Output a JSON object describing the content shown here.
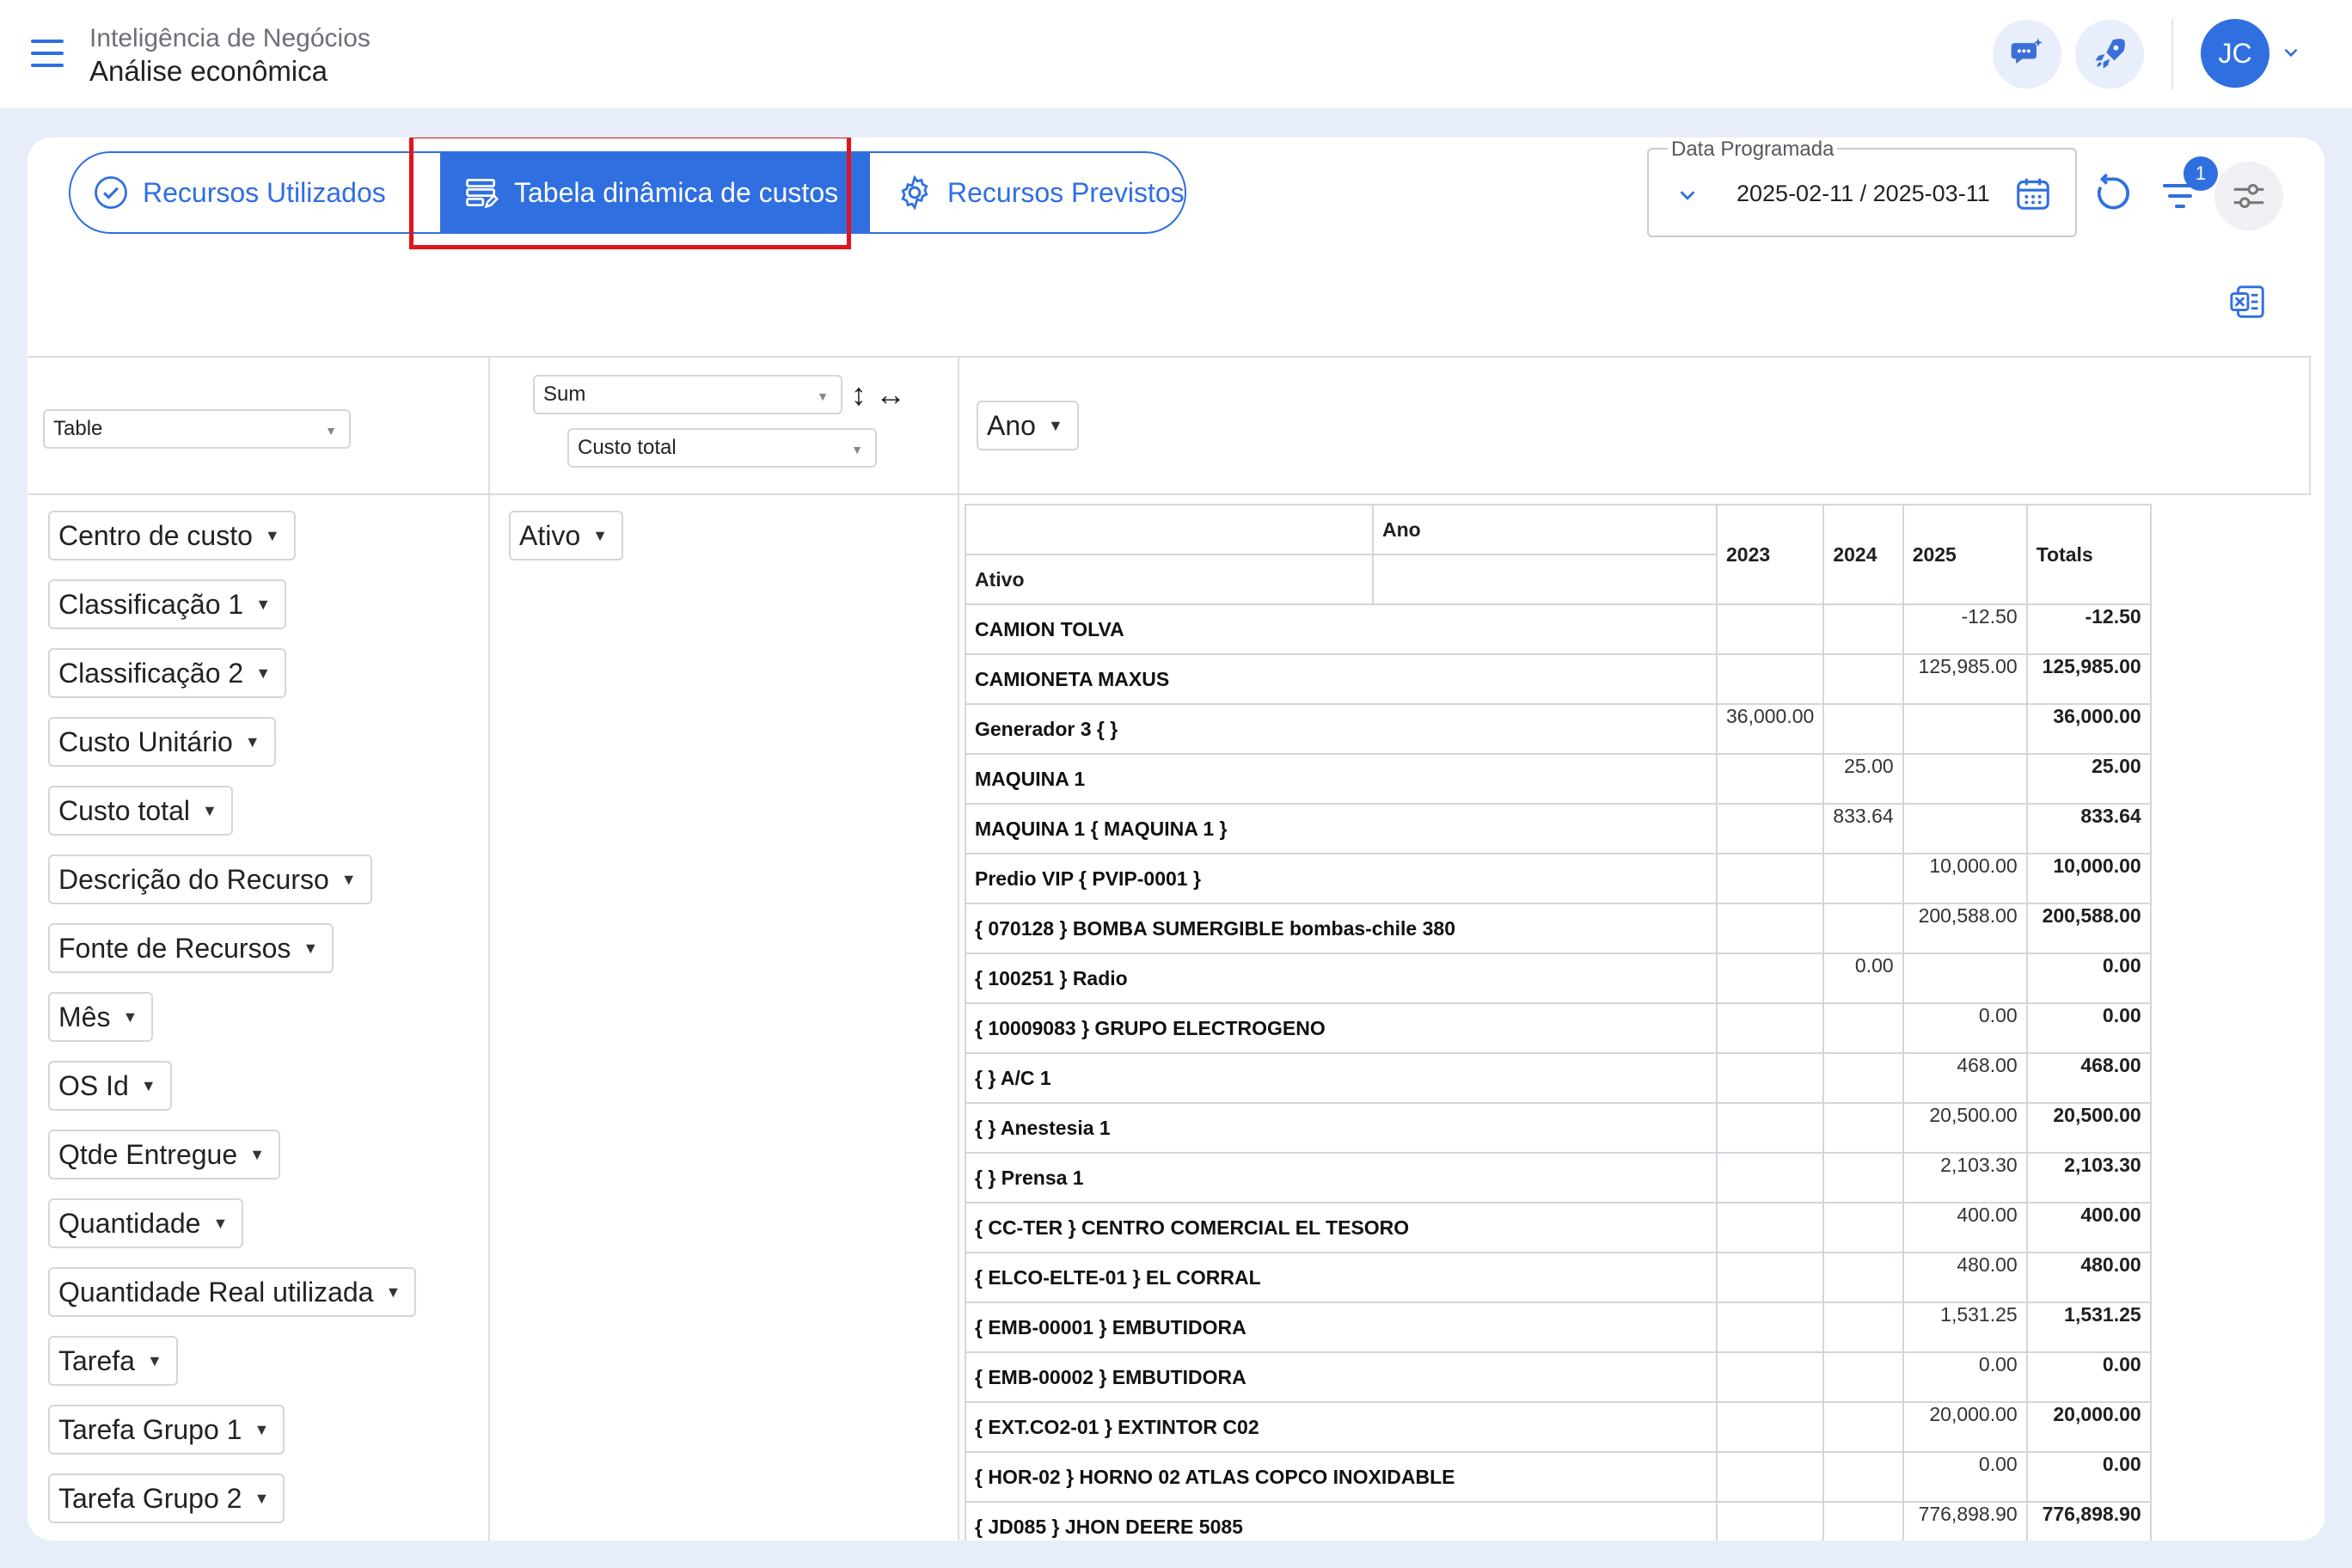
{
  "header": {
    "subtitle": "Inteligência de Negócios",
    "title": "Análise econômica",
    "avatar_initials": "JC"
  },
  "tabs": [
    {
      "label": "Recursos Utilizados",
      "icon": "check-circle-icon"
    },
    {
      "label": "Tabela dinâmica de custos",
      "icon": "table-edit-icon"
    },
    {
      "label": "Recursos Previstos",
      "icon": "gear-icon"
    }
  ],
  "date_filter": {
    "legend": "Data Programada",
    "value": "2025-02-11 / 2025-03-11"
  },
  "filter_badge": "1",
  "pivot": {
    "renderer": "Table",
    "aggregator": "Sum",
    "value_field": "Custo total",
    "col_field": "Ano",
    "row_field": "Ativo",
    "unused_fields": [
      "Centro de custo",
      "Classificação 1",
      "Classificação 2",
      "Custo Unitário",
      "Custo total",
      "Descrição do Recurso",
      "Fonte de Recursos",
      "Mês",
      "OS Id",
      "Qtde Entregue",
      "Quantidade",
      "Quantidade Real utilizada",
      "Tarefa",
      "Tarefa Grupo 1",
      "Tarefa Grupo 2"
    ],
    "sort_arrows": "↕ ↔",
    "table": {
      "col_header_label": "Ano",
      "row_header_label": "Ativo",
      "years": [
        "2023",
        "2024",
        "2025"
      ],
      "totals_label": "Totals",
      "rows": [
        {
          "label": "CAMION TOLVA",
          "v2023": "",
          "v2024": "",
          "v2025": "-12.50",
          "total": "-12.50"
        },
        {
          "label": "CAMIONETA MAXUS",
          "v2023": "",
          "v2024": "",
          "v2025": "125,985.00",
          "total": "125,985.00"
        },
        {
          "label": "Generador 3 { }",
          "v2023": "36,000.00",
          "v2024": "",
          "v2025": "",
          "total": "36,000.00"
        },
        {
          "label": "MAQUINA 1",
          "v2023": "",
          "v2024": "25.00",
          "v2025": "",
          "total": "25.00"
        },
        {
          "label": "MAQUINA 1 { MAQUINA 1 }",
          "v2023": "",
          "v2024": "833.64",
          "v2025": "",
          "total": "833.64"
        },
        {
          "label": "Predio VIP { PVIP-0001 }",
          "v2023": "",
          "v2024": "",
          "v2025": "10,000.00",
          "total": "10,000.00"
        },
        {
          "label": "{ 070128 } BOMBA SUMERGIBLE bombas-chile 380",
          "v2023": "",
          "v2024": "",
          "v2025": "200,588.00",
          "total": "200,588.00"
        },
        {
          "label": "{ 100251 } Radio",
          "v2023": "",
          "v2024": "0.00",
          "v2025": "",
          "total": "0.00"
        },
        {
          "label": "{ 10009083 } GRUPO ELECTROGENO",
          "v2023": "",
          "v2024": "",
          "v2025": "0.00",
          "total": "0.00"
        },
        {
          "label": "{ } A/C 1",
          "v2023": "",
          "v2024": "",
          "v2025": "468.00",
          "total": "468.00"
        },
        {
          "label": "{ } Anestesia 1",
          "v2023": "",
          "v2024": "",
          "v2025": "20,500.00",
          "total": "20,500.00"
        },
        {
          "label": "{ } Prensa 1",
          "v2023": "",
          "v2024": "",
          "v2025": "2,103.30",
          "total": "2,103.30"
        },
        {
          "label": "{ CC-TER } CENTRO COMERCIAL EL TESORO",
          "v2023": "",
          "v2024": "",
          "v2025": "400.00",
          "total": "400.00"
        },
        {
          "label": "{ ELCO-ELTE-01 } EL CORRAL",
          "v2023": "",
          "v2024": "",
          "v2025": "480.00",
          "total": "480.00"
        },
        {
          "label": "{ EMB-00001 } EMBUTIDORA",
          "v2023": "",
          "v2024": "",
          "v2025": "1,531.25",
          "total": "1,531.25"
        },
        {
          "label": "{ EMB-00002 } EMBUTIDORA",
          "v2023": "",
          "v2024": "",
          "v2025": "0.00",
          "total": "0.00"
        },
        {
          "label": "{ EXT.CO2-01 } EXTINTOR C02",
          "v2023": "",
          "v2024": "",
          "v2025": "20,000.00",
          "total": "20,000.00"
        },
        {
          "label": "{ HOR-02 } HORNO 02 ATLAS COPCO INOXIDABLE",
          "v2023": "",
          "v2024": "",
          "v2025": "0.00",
          "total": "0.00"
        },
        {
          "label": "{ JD085 } JHON DEERE 5085",
          "v2023": "",
          "v2024": "",
          "v2025": "776,898.90",
          "total": "776,898.90"
        }
      ]
    }
  },
  "colors": {
    "accent": "#2f6fe0",
    "highlight": "#e1141b"
  }
}
